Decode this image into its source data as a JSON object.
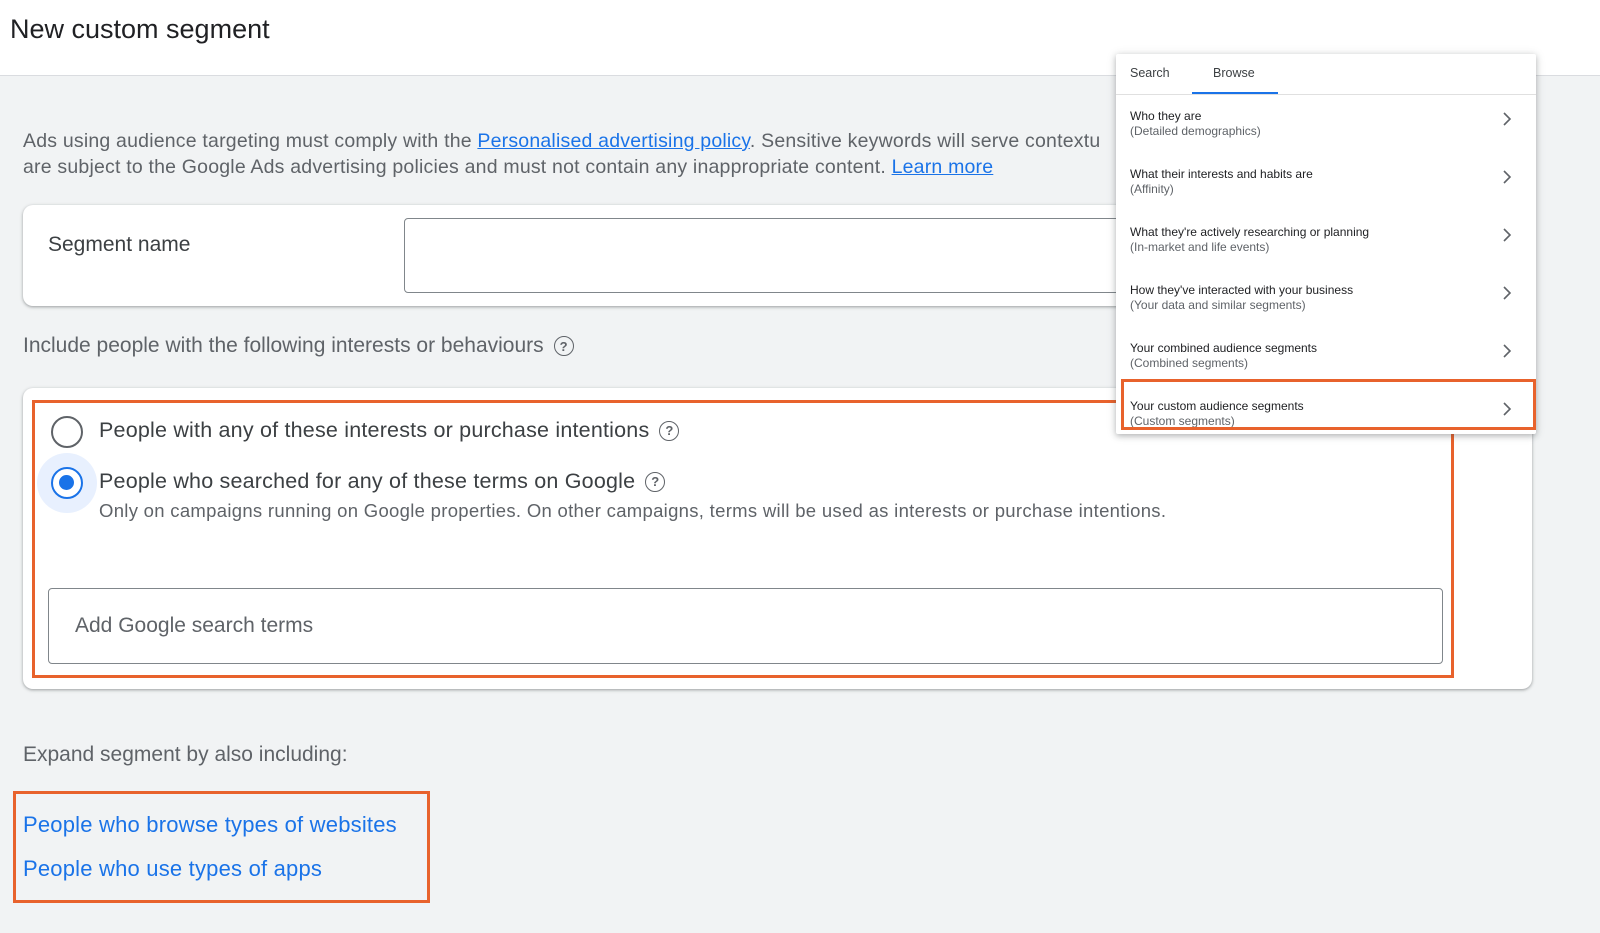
{
  "header": {
    "title": "New custom segment"
  },
  "notice": {
    "text_before": "Ads using audience targeting must comply with the ",
    "policy_link": "Personalised advertising policy",
    "text_middle": ". Sensitive keywords will serve contextu",
    "text_line2": "are subject to the Google Ads advertising policies and must not contain any inappropriate content. ",
    "learn_more": "Learn more"
  },
  "segment_name": {
    "label": "Segment name",
    "value": ""
  },
  "include": {
    "label": "Include people with the following interests or behaviours",
    "help_icon": "help-circle-icon",
    "options": [
      {
        "label": "People with any of these interests or purchase intentions",
        "selected": false
      },
      {
        "label": "People who searched for any of these terms on Google",
        "selected": true
      }
    ],
    "search_note": "Only on campaigns running on Google properties. On other campaigns, terms will be used as interests or purchase intentions.",
    "terms_placeholder": "Add Google search terms"
  },
  "expand": {
    "label": "Expand segment by also including:",
    "links": [
      "People who browse types of websites",
      "People who use types of apps"
    ]
  },
  "browse_panel": {
    "tabs": [
      "Search",
      "Browse"
    ],
    "active_tab": "Browse",
    "items": [
      {
        "title": "Who they are",
        "subtitle": "(Detailed demographics)"
      },
      {
        "title": "What their interests and habits are",
        "subtitle": "(Affinity)"
      },
      {
        "title": "What they're actively researching or planning",
        "subtitle": "(In-market and life events)"
      },
      {
        "title": "How they've interacted with your business",
        "subtitle": "(Your data and similar segments)"
      },
      {
        "title": "Your combined audience segments",
        "subtitle": "(Combined segments)"
      },
      {
        "title": "Your custom audience segments",
        "subtitle": "(Custom segments)"
      }
    ]
  },
  "colors": {
    "accent": "#1a73e8",
    "highlight": "#e8622c"
  }
}
